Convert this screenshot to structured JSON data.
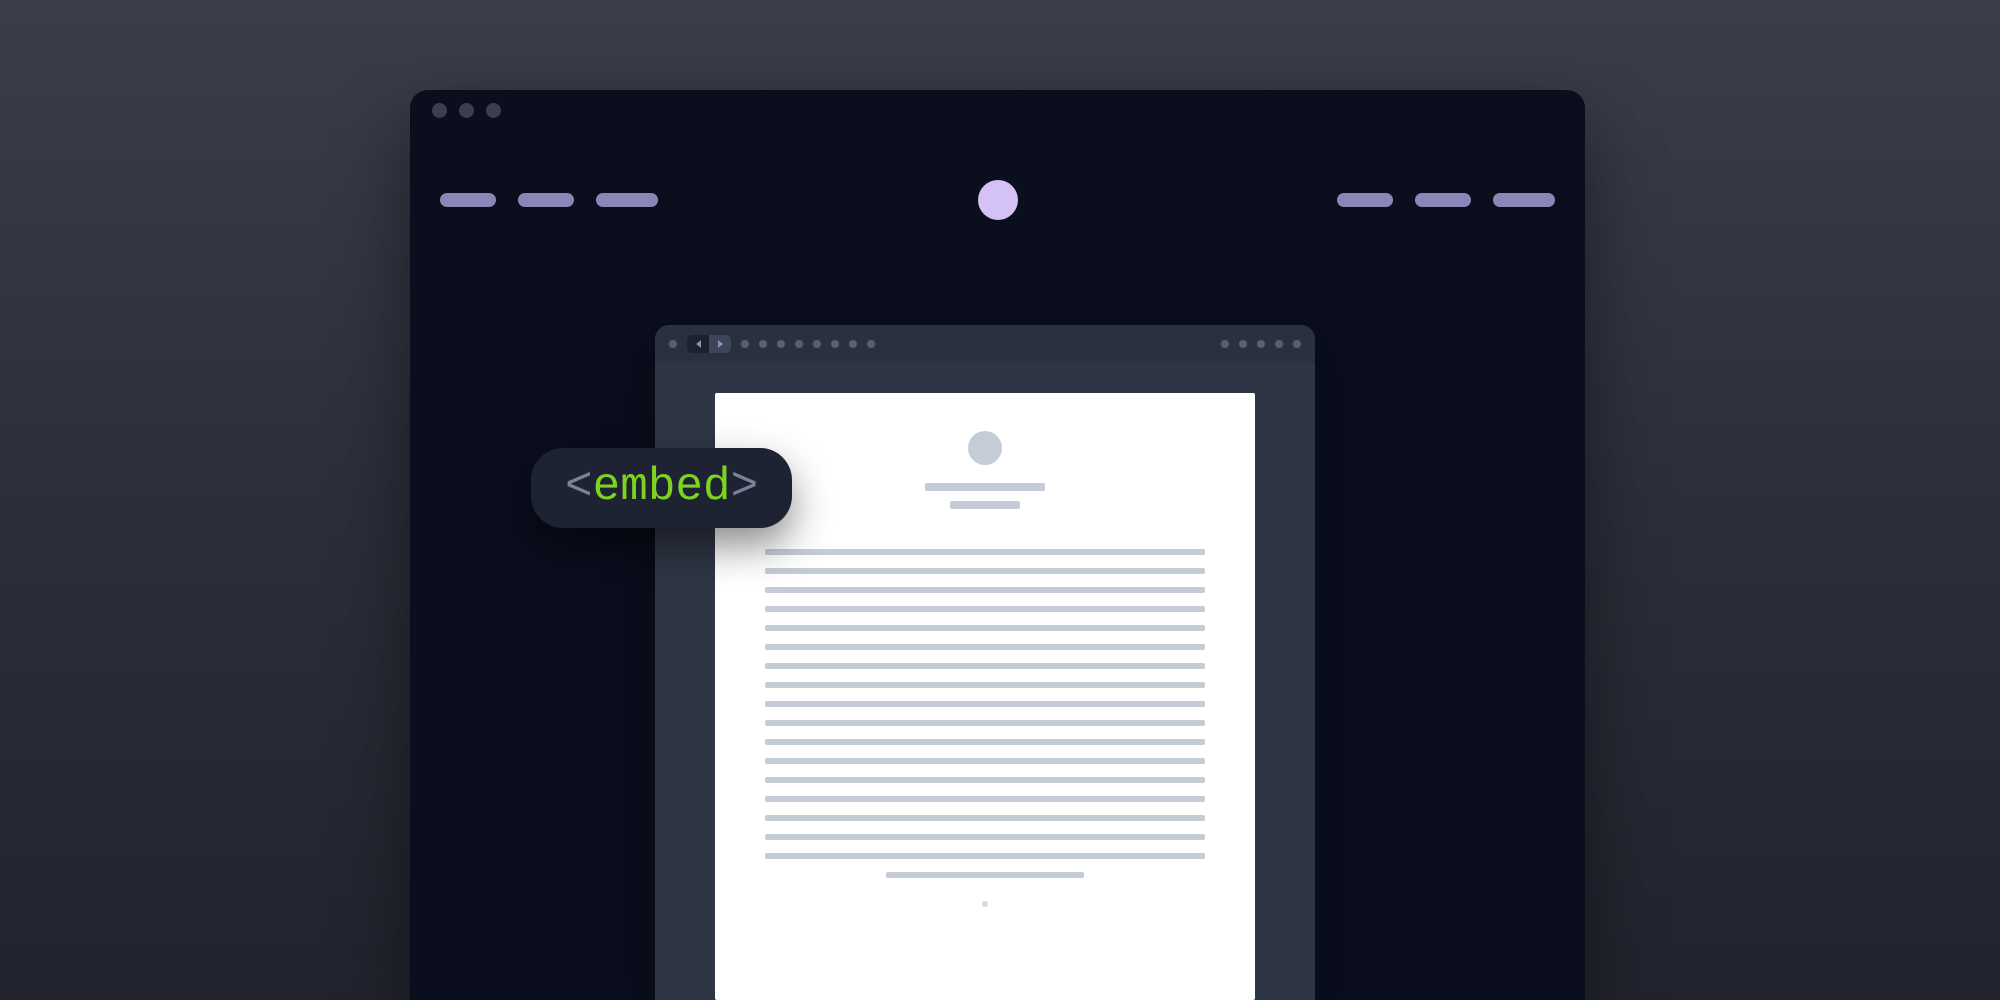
{
  "embed_tag": {
    "open_bracket": "<",
    "tag_name": "embed",
    "close_bracket": ">"
  }
}
